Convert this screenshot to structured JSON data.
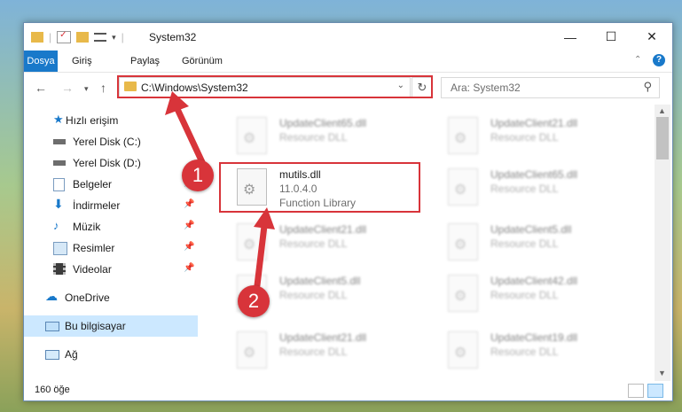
{
  "window": {
    "title": "System32",
    "controls": {
      "minimize": "—",
      "maximize": "☐",
      "close": "✕"
    }
  },
  "ribbon": {
    "tabs": [
      "Dosya",
      "Giriş",
      "Paylaş",
      "Görünüm"
    ],
    "collapse_icon": "chevron-up-icon",
    "help_icon": "?"
  },
  "address": {
    "path": "C:\\Windows\\System32",
    "search_placeholder": "Ara: System32"
  },
  "nav": {
    "items": [
      {
        "label": "Hızlı erişim",
        "icon": "star-icon"
      },
      {
        "label": "Yerel Disk (C:)",
        "icon": "drive-icon"
      },
      {
        "label": "Yerel Disk (D:)",
        "icon": "drive-icon"
      },
      {
        "label": "Belgeler",
        "icon": "documents-icon"
      },
      {
        "label": "İndirmeler",
        "icon": "download-icon"
      },
      {
        "label": "Müzik",
        "icon": "music-icon"
      },
      {
        "label": "Resimler",
        "icon": "pictures-icon"
      },
      {
        "label": "Videolar",
        "icon": "video-icon"
      },
      {
        "label": "OneDrive",
        "icon": "cloud-icon"
      },
      {
        "label": "Bu bilgisayar",
        "icon": "computer-icon"
      },
      {
        "label": "Ağ",
        "icon": "network-icon"
      }
    ]
  },
  "files": {
    "highlighted": {
      "name": "mutils.dll",
      "version": "11.0.4.0",
      "description": "Function Library"
    },
    "background": [
      {
        "name": "UpdateClient65.dll",
        "type": "Resource DLL"
      },
      {
        "name": "UpdateClient21.dll",
        "type": "Resource DLL"
      },
      {
        "name": "UpdateClient65.dll",
        "type": "Resource DLL"
      },
      {
        "name": "UpdateClient21.dll",
        "type": "Resource DLL"
      },
      {
        "name": "UpdateClient5.dll",
        "type": "Resource DLL"
      },
      {
        "name": "UpdateClient5.dll",
        "type": "Resource DLL"
      },
      {
        "name": "UpdateClient42.dll",
        "type": "Resource DLL"
      },
      {
        "name": "UpdateClient21.dll",
        "type": "Resource DLL"
      },
      {
        "name": "UpdateClient19.dll",
        "type": "Resource DLL"
      }
    ]
  },
  "status": {
    "count": "160 öğe"
  },
  "callouts": [
    "1",
    "2"
  ],
  "colors": {
    "accent": "#1979ca",
    "highlight": "#d8343a",
    "selected": "#cce8ff"
  }
}
